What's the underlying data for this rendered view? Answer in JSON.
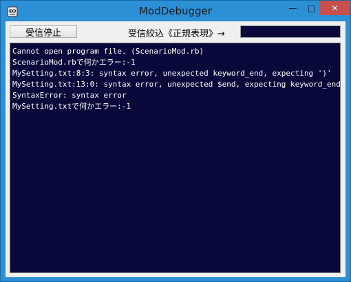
{
  "window": {
    "title": "ModDebugger",
    "minimize_glyph": "—",
    "maximize_glyph": "□",
    "close_glyph": "✕",
    "app_icon": "bug-icon",
    "accent_color": "#2b90d6",
    "close_color": "#c7504a"
  },
  "toolbar": {
    "recv_stop_label": "受信停止",
    "filter_label": "受信絞込《正規表現》→",
    "filter_value": ""
  },
  "console": {
    "background": "#08083a",
    "lines": [
      "Cannot open program file. (ScenarioMod.rb)",
      "ScenarioMod.rbで何かエラー:-1",
      "MySetting.txt:8:3: syntax error, unexpected keyword_end, expecting ')'",
      "MySetting.txt:13:0: syntax error, unexpected $end, expecting keyword_end",
      "SyntaxError: syntax error",
      "MySetting.txtで何かエラー:-1"
    ]
  }
}
